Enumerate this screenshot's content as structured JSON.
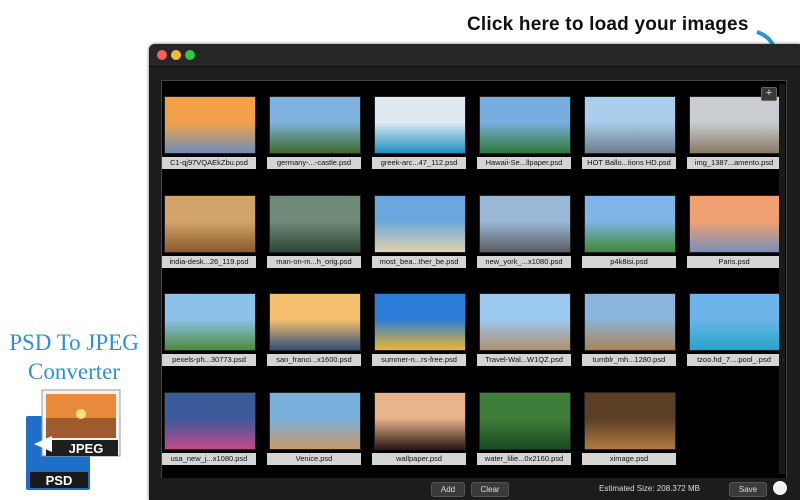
{
  "callout": {
    "text": "Click here to load your images"
  },
  "brand": {
    "line1": "PSD To JPEG",
    "line2": "Converter",
    "logo_top": "JPEG",
    "logo_bottom": "PSD"
  },
  "window": {
    "add_glyph": "+"
  },
  "images": [
    {
      "name": "C1-qj97VQAEkZbu.psd",
      "colors": [
        "#f2a14a",
        "#6d8fb8"
      ]
    },
    {
      "name": "germany-...-castle.psd",
      "colors": [
        "#7fb2de",
        "#3d6b2c"
      ]
    },
    {
      "name": "greek-arc...47_112.psd",
      "colors": [
        "#dfe9f2",
        "#1e8fc2"
      ]
    },
    {
      "name": "Hawaii-Se...llpaper.psd",
      "colors": [
        "#77aee0",
        "#2f7a3a"
      ]
    },
    {
      "name": "HOT Ballo...tions HD.psd",
      "colors": [
        "#a9cdeb",
        "#6e7d8e"
      ]
    },
    {
      "name": "img_1387...amento.psd",
      "colors": [
        "#c9cdd2",
        "#8a7a62"
      ]
    },
    {
      "name": "india-desk...26_119.psd",
      "colors": [
        "#d2a46a",
        "#8a5a2a"
      ]
    },
    {
      "name": "man-on-m...h_orig.psd",
      "colors": [
        "#6f8a78",
        "#2e4636"
      ]
    },
    {
      "name": "most_bea...ther_be.psd",
      "colors": [
        "#6aa7dc",
        "#e0d2b0"
      ]
    },
    {
      "name": "new_york_...x1080.psd",
      "colors": [
        "#9ab8d6",
        "#5a5a62"
      ]
    },
    {
      "name": "p4k8isi.psd",
      "colors": [
        "#7fb5e6",
        "#3d8a36"
      ]
    },
    {
      "name": "Paris.psd",
      "colors": [
        "#f0a070",
        "#7a8fb8"
      ]
    },
    {
      "name": "pexels-ph...30773.psd",
      "colors": [
        "#8cc2ea",
        "#4c8a3c"
      ]
    },
    {
      "name": "san_franci...x1600.psd",
      "colors": [
        "#f6c070",
        "#304e78"
      ]
    },
    {
      "name": "summer-n...rs-free.psd",
      "colors": [
        "#2a7cd6",
        "#e8b830"
      ]
    },
    {
      "name": "Travel-Wal...W1QZ.psd",
      "colors": [
        "#9ac8ee",
        "#b09070"
      ]
    },
    {
      "name": "tumblr_mh...1280.psd",
      "colors": [
        "#8ab4da",
        "#a88658"
      ]
    },
    {
      "name": "tzoo.hd_7....pool_.psd",
      "colors": [
        "#6cb4ea",
        "#23a6c8"
      ]
    },
    {
      "name": "usa_new_j...x1080.psd",
      "colors": [
        "#3a5a9a",
        "#c24a8a"
      ]
    },
    {
      "name": "Venice.psd",
      "colors": [
        "#7ab0dc",
        "#c89a6a"
      ]
    },
    {
      "name": "wallpaper.psd",
      "colors": [
        "#e9b38c",
        "#2a1a14"
      ]
    },
    {
      "name": "water_lilie...0x2160.psd",
      "colors": [
        "#3f7e3a",
        "#1a4a22"
      ]
    },
    {
      "name": "ximage.psd",
      "colors": [
        "#5a3e26",
        "#b07a40"
      ]
    }
  ],
  "bottom": {
    "add_label": "Add",
    "clear_label": "Clear",
    "estimated_size": "Estimated Size: 208.372 MB",
    "save_label": "Save"
  }
}
